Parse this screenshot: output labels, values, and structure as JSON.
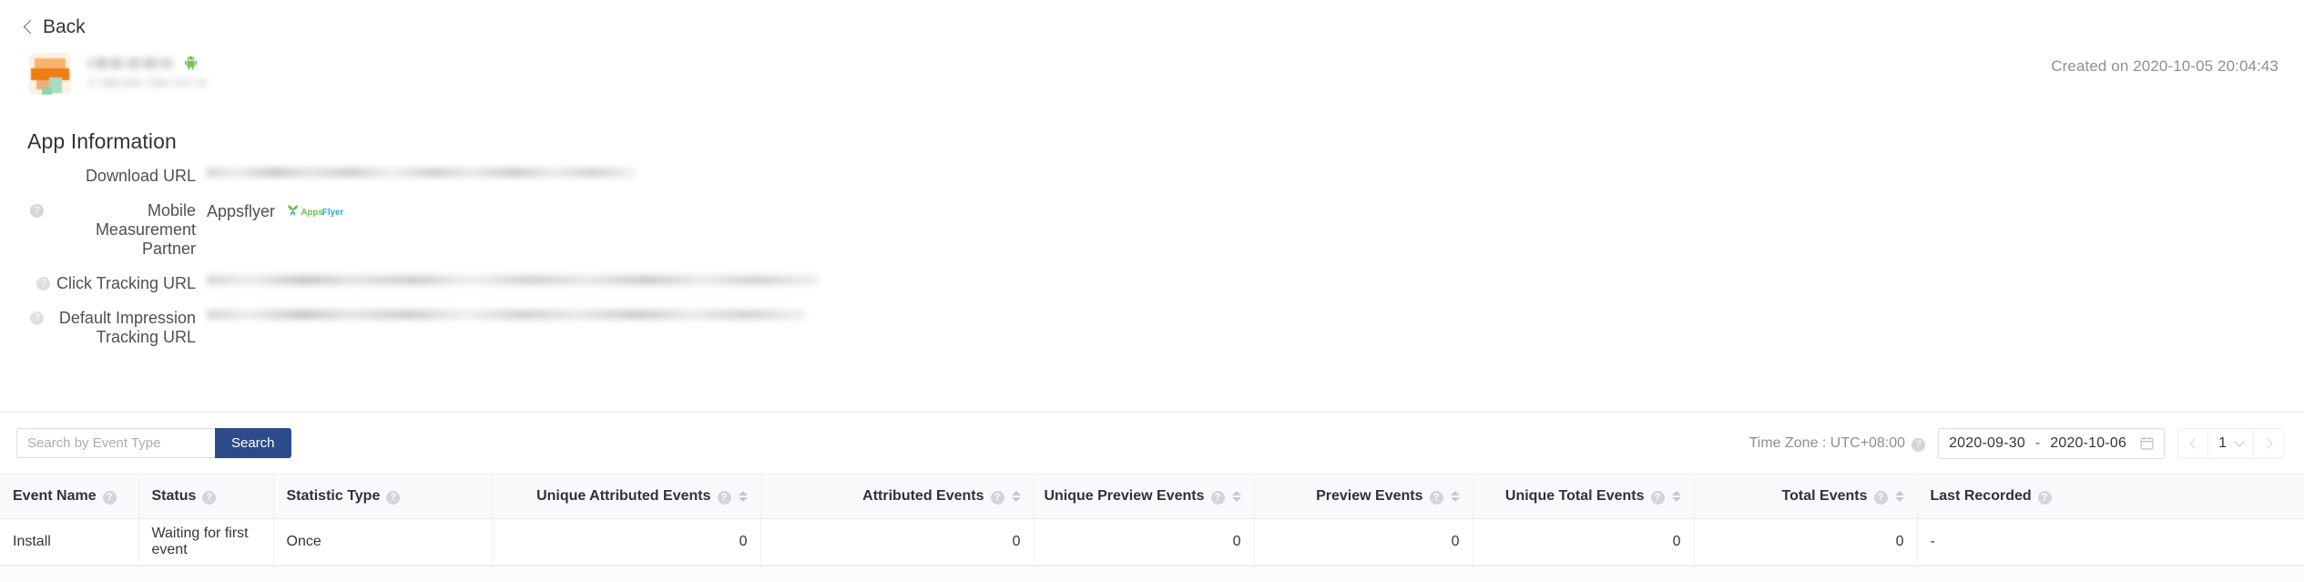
{
  "nav": {
    "back_label": "Back",
    "back_icon": "chevron-left-icon"
  },
  "app_header": {
    "platform_icon": "android-icon",
    "app_name_redacted": "",
    "app_id_redacted": "",
    "created_on": "Created on 2020-10-05 20:04:43"
  },
  "app_information": {
    "section_title": "App Information",
    "rows": [
      {
        "label": "Download URL",
        "has_help": false,
        "value_type": "redacted-url",
        "value": ""
      },
      {
        "label": "Mobile Measurement Partner",
        "has_help": true,
        "value_type": "partner",
        "value": "Appsflyer",
        "logo": "appsflyer-logo"
      },
      {
        "label": "Click Tracking URL",
        "has_help": true,
        "value_type": "redacted-url",
        "value": ""
      },
      {
        "label": "Default Impression Tracking URL",
        "has_help": true,
        "value_type": "redacted-url",
        "value": ""
      }
    ]
  },
  "toolbar": {
    "search_placeholder": "Search by Event Type",
    "search_value": "",
    "search_button": "Search",
    "search_button_color": "#2c4b8b",
    "timezone_label": "Time Zone : UTC+08:00",
    "timezone_help_icon": "help-circle-icon",
    "date_start": "2020-09-30",
    "date_separator": "-",
    "date_end": "2020-10-06",
    "calendar_icon": "calendar-icon",
    "pagination": {
      "prev_icon": "chevron-left-icon",
      "next_icon": "chevron-right-icon",
      "current_page": "1",
      "dropdown_icon": "chevron-down-icon"
    }
  },
  "table": {
    "columns": [
      {
        "label": "Event Name",
        "help": true,
        "sortable": false,
        "align": "left"
      },
      {
        "label": "Status",
        "help": true,
        "sortable": false,
        "align": "left"
      },
      {
        "label": "Statistic Type",
        "help": true,
        "sortable": false,
        "align": "left"
      },
      {
        "label": "Unique Attributed Events",
        "help": true,
        "sortable": true,
        "align": "right"
      },
      {
        "label": "Attributed Events",
        "help": true,
        "sortable": true,
        "align": "right"
      },
      {
        "label": "Unique Preview Events",
        "help": true,
        "sortable": true,
        "align": "right"
      },
      {
        "label": "Preview Events",
        "help": true,
        "sortable": true,
        "align": "right"
      },
      {
        "label": "Unique Total Events",
        "help": true,
        "sortable": true,
        "align": "right"
      },
      {
        "label": "Total Events",
        "help": true,
        "sortable": true,
        "align": "right"
      },
      {
        "label": "Last Recorded",
        "help": true,
        "sortable": false,
        "align": "left"
      }
    ],
    "rows": [
      {
        "event_name": "Install",
        "status": "Waiting for first event",
        "statistic_type": "Once",
        "unique_attributed_events": "0",
        "attributed_events": "0",
        "unique_preview_events": "0",
        "preview_events": "0",
        "unique_total_events": "0",
        "total_events": "0",
        "last_recorded": "-"
      }
    ]
  }
}
